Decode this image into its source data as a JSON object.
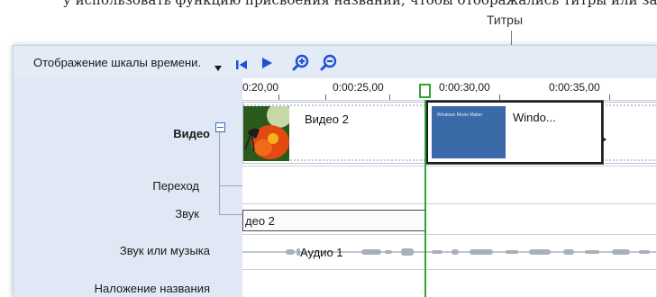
{
  "top_strip_text": "у использовать функцию присвоения названий, чтобы отображались титры или заголовок,",
  "callout": {
    "label": "Титры"
  },
  "toolbar": {
    "view_label": "Отображение шкалы времени.",
    "dropdown_icon": "triangle-down-icon",
    "buttons": [
      "rewind-icon",
      "play-icon",
      "zoom-in-icon",
      "zoom-out-icon"
    ]
  },
  "tracks": {
    "video": "Видео",
    "transition": "Переход",
    "sound": "Звук",
    "sound_or_music": "Звук или музыка",
    "title_overlay": "Наложение названия"
  },
  "ruler": {
    "labels": [
      "0:20,00",
      "0:00:25,00",
      "0:00:30,00",
      "0:00:35,00"
    ]
  },
  "clips": {
    "video2": "Видео 2",
    "title_clip": "Windo...",
    "title_thumb_text": "Windows Movie Maker",
    "audio_track_clip": "део 2",
    "audio1": "Аудио 1"
  },
  "colors": {
    "panel_bg": "#dfe8f4",
    "playhead": "#2fa43a",
    "toolbar_icons": "#1f4fd6"
  }
}
